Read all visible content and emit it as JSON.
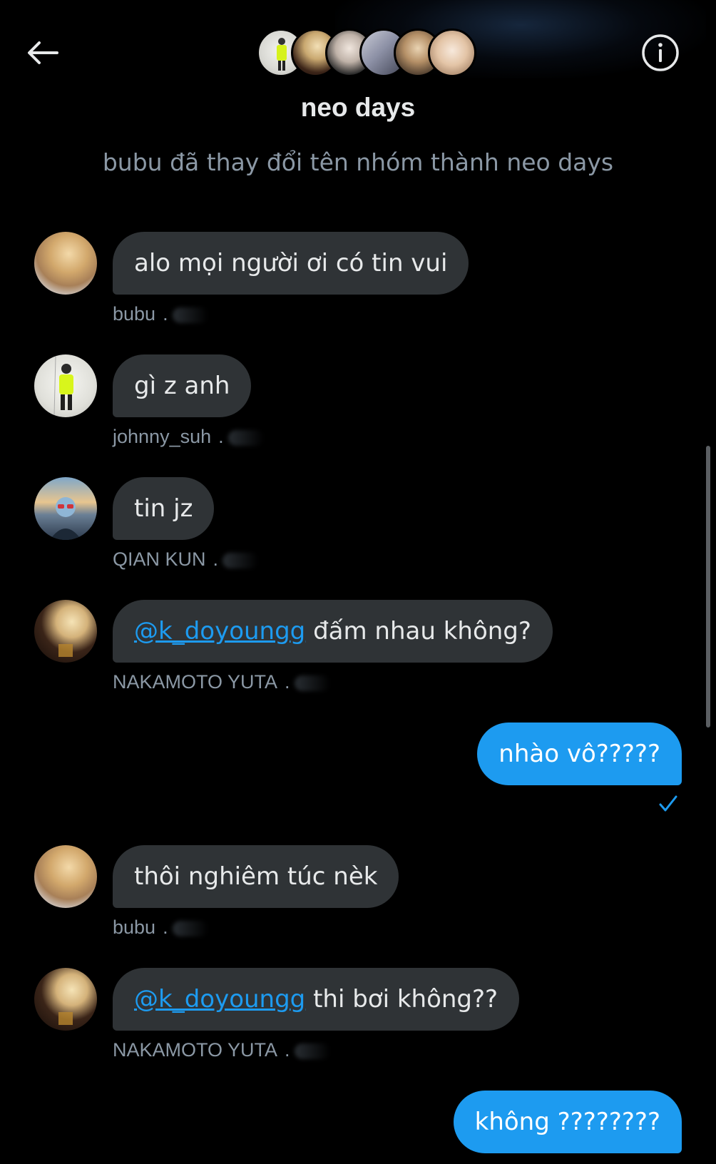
{
  "header": {
    "group_name": "neo days",
    "back_icon": "arrow-left-icon",
    "info_icon": "info-circle-icon"
  },
  "system_message": "bubu đã thay đổi tên nhóm thành neo days",
  "messages": [
    {
      "type": "in",
      "text": "alo mọi người ơi có tin vui",
      "sender": "bubu"
    },
    {
      "type": "in",
      "text": "gì z anh",
      "sender": "johnny_suh"
    },
    {
      "type": "in",
      "text": "tin jz",
      "sender": "QIAN KUN"
    },
    {
      "type": "in",
      "mention": "@k_doyoungg",
      "text": " đấm nhau không?",
      "sender": "NAKAMOTO YUTA"
    },
    {
      "type": "out",
      "text": "nhào vô?????"
    },
    {
      "type": "in",
      "text": "thôi nghiêm túc nèk",
      "sender": "bubu"
    },
    {
      "type": "in",
      "mention": "@k_doyoungg",
      "text": " thi bơi không??",
      "sender": "NAKAMOTO YUTA"
    },
    {
      "type": "out",
      "text": "không ????????"
    }
  ],
  "colors": {
    "background": "#000000",
    "incoming_bubble": "#2f3336",
    "outgoing_bubble": "#1d9bf0",
    "mention": "#1d9bf0",
    "muted_text": "#8b98a5"
  }
}
